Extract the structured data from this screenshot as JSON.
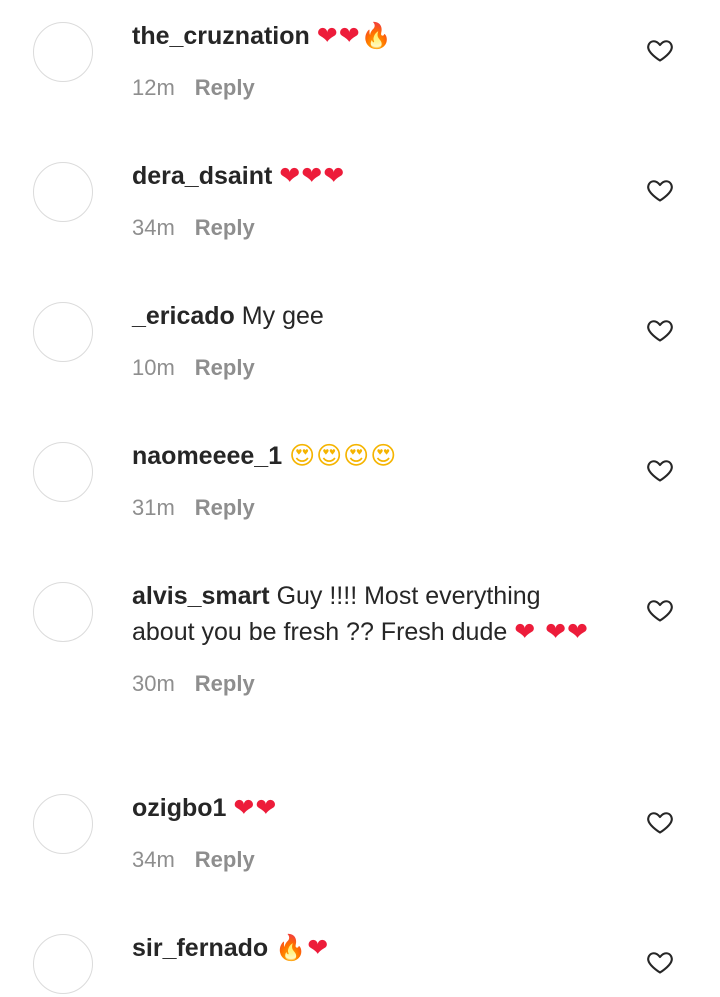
{
  "comments": [
    {
      "username": "the_cruznation",
      "text": "",
      "emoji": [
        {
          "g": "❤❤",
          "k": "heart"
        },
        {
          "g": "🔥",
          "k": "fire"
        }
      ],
      "time": "12m",
      "reply": "Reply"
    },
    {
      "username": "dera_dsaint",
      "text": "",
      "emoji": [
        {
          "g": "❤❤❤",
          "k": "heart"
        }
      ],
      "time": "34m",
      "reply": "Reply"
    },
    {
      "username": "_ericado",
      "text": "My gee",
      "emoji": [],
      "time": "10m",
      "reply": "Reply"
    },
    {
      "username": "naomeeee_1",
      "text": "",
      "emoji": [
        {
          "g": "😍😍😍😍",
          "k": "face"
        }
      ],
      "time": "31m",
      "reply": "Reply"
    },
    {
      "username": "alvis_smart",
      "text": "Guy !!!! Most everything about you be fresh ?? Fresh dude",
      "emoji": [
        {
          "g": "❤ ❤❤",
          "k": "heart"
        }
      ],
      "time": "30m",
      "reply": "Reply"
    },
    {
      "username": "ozigbo1",
      "text": "",
      "emoji": [
        {
          "g": "❤❤",
          "k": "heart"
        }
      ],
      "time": "34m",
      "reply": "Reply"
    },
    {
      "username": "sir_fernado",
      "text": "",
      "emoji": [
        {
          "g": "🔥",
          "k": "fire"
        },
        {
          "g": "❤",
          "k": "heart"
        }
      ],
      "time": "",
      "reply": ""
    }
  ],
  "icons": {
    "avatar": "avatar-placeholder",
    "like": "heart-outline-icon"
  },
  "colors": {
    "text": "#262626",
    "meta": "#8e8e8e",
    "avatar_border": "#dbdbdb",
    "heart": "#ed1c3a"
  }
}
